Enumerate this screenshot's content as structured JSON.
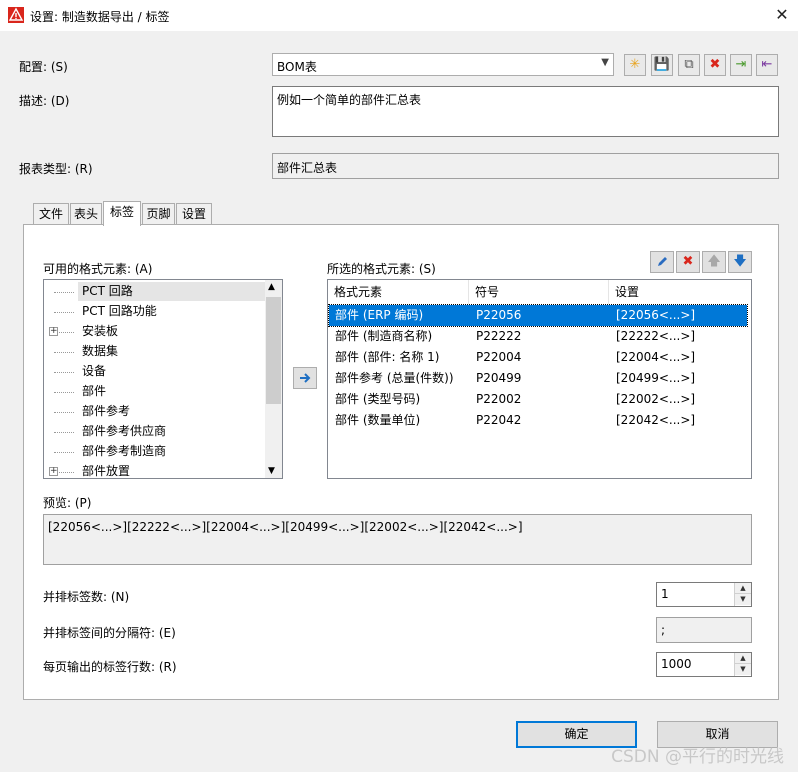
{
  "window": {
    "title": "设置: 制造数据导出 / 标签",
    "close_symbol": "✕"
  },
  "config": {
    "label": "配置: (S)",
    "value": "BOM表",
    "toolbar": [
      "new-icon",
      "save-icon",
      "copy-icon",
      "delete-icon",
      "import-icon",
      "export-icon"
    ]
  },
  "description": {
    "label": "描述: (D)",
    "value": "例如一个简单的部件汇总表"
  },
  "report_type": {
    "label": "报表类型: (R)",
    "value": "部件汇总表"
  },
  "tabs": [
    {
      "label": "文件",
      "active": false
    },
    {
      "label": "表头",
      "active": false
    },
    {
      "label": "标签",
      "active": true
    },
    {
      "label": "页脚",
      "active": false
    },
    {
      "label": "设置",
      "active": false
    }
  ],
  "available": {
    "label": "可用的格式元素: (A)",
    "items": [
      {
        "label": "PCT 回路",
        "expandable": false,
        "selected": true
      },
      {
        "label": "PCT 回路功能",
        "expandable": false,
        "selected": false
      },
      {
        "label": "安装板",
        "expandable": true,
        "selected": false
      },
      {
        "label": "数据集",
        "expandable": false,
        "selected": false
      },
      {
        "label": "设备",
        "expandable": false,
        "selected": false
      },
      {
        "label": "部件",
        "expandable": false,
        "selected": false
      },
      {
        "label": "部件参考",
        "expandable": false,
        "selected": false
      },
      {
        "label": "部件参考供应商",
        "expandable": false,
        "selected": false
      },
      {
        "label": "部件参考制造商",
        "expandable": false,
        "selected": false
      },
      {
        "label": "部件放置",
        "expandable": true,
        "selected": false
      }
    ]
  },
  "selected_elements": {
    "label": "所选的格式元素: (S)",
    "columns": [
      "格式元素",
      "符号",
      "设置"
    ],
    "rows": [
      {
        "element": "部件 (ERP 编码)",
        "symbol": "P22056",
        "setting": "[22056<...>]",
        "selected": true
      },
      {
        "element": "部件 (制造商名称)",
        "symbol": "P22222",
        "setting": "[22222<...>]",
        "selected": false
      },
      {
        "element": "部件 (部件: 名称 1)",
        "symbol": "P22004",
        "setting": "[22004<...>]",
        "selected": false
      },
      {
        "element": "部件参考 (总量(件数))",
        "symbol": "P20499",
        "setting": "[20499<...>]",
        "selected": false
      },
      {
        "element": "部件 (类型号码)",
        "symbol": "P22002",
        "setting": "[22002<...>]",
        "selected": false
      },
      {
        "element": "部件 (数量单位)",
        "symbol": "P22042",
        "setting": "[22042<...>]",
        "selected": false
      }
    ]
  },
  "preview": {
    "label": "预览: (P)",
    "value": "[22056<...>][22222<...>][22004<...>][20499<...>][22002<...>][22042<...>]"
  },
  "labels_side_by_side": {
    "label": "并排标签数: (N)",
    "value": "1"
  },
  "separator": {
    "label": "并排标签间的分隔符: (E)",
    "value": ";"
  },
  "rows_per_page": {
    "label": "每页输出的标签行数: (R)",
    "value": "1000"
  },
  "buttons": {
    "ok": "确定",
    "cancel": "取消"
  },
  "watermark": "CSDN @平行的时光线",
  "colors": {
    "selection": "#0078d7",
    "title_icon": "#d9261c"
  }
}
